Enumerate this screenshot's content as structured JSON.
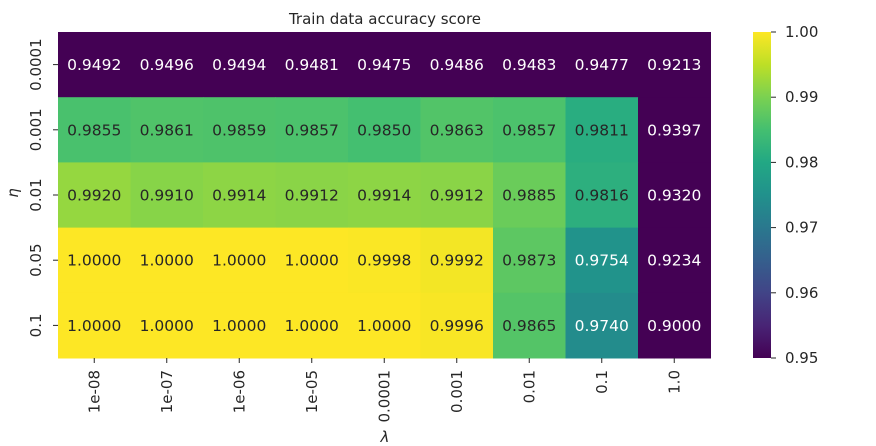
{
  "chart_data": {
    "type": "heatmap",
    "title": "Train data accuracy score",
    "xlabel": "λ",
    "ylabel": "η",
    "x": [
      "1e-08",
      "1e-07",
      "1e-06",
      "1e-05",
      "0.0001",
      "0.001",
      "0.01",
      "0.1",
      "1.0"
    ],
    "y": [
      "0.0001",
      "0.001",
      "0.01",
      "0.05",
      "0.1"
    ],
    "values": [
      [
        0.9492,
        0.9496,
        0.9494,
        0.9481,
        0.9475,
        0.9486,
        0.9483,
        0.9477,
        0.9213
      ],
      [
        0.9855,
        0.9861,
        0.9859,
        0.9857,
        0.985,
        0.9863,
        0.9857,
        0.9811,
        0.9397
      ],
      [
        0.992,
        0.991,
        0.9914,
        0.9912,
        0.9914,
        0.9912,
        0.9885,
        0.9816,
        0.932
      ],
      [
        1.0,
        1.0,
        1.0,
        1.0,
        0.9998,
        0.9992,
        0.9873,
        0.9754,
        0.9234
      ],
      [
        1.0,
        1.0,
        1.0,
        1.0,
        1.0,
        0.9996,
        0.9865,
        0.974,
        0.9
      ]
    ],
    "value_format": "4 decimals",
    "colormap": "viridis",
    "colorbar": {
      "vmin": 0.95,
      "vmax": 1.0,
      "ticks": [
        "0.95",
        "0.96",
        "0.97",
        "0.98",
        "0.99",
        "1.00"
      ]
    },
    "grid": false
  }
}
